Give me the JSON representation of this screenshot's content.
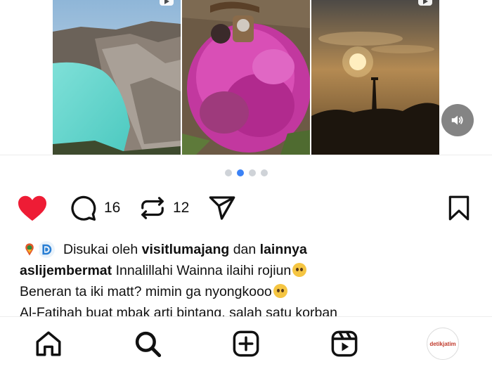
{
  "media": {
    "tiles": [
      {
        "name": "crater-lake-photo",
        "badge": "reel-icon"
      },
      {
        "name": "flower-grave-photo",
        "badge": "none"
      },
      {
        "name": "sunset-tower-photo",
        "badge": "reel-icon"
      }
    ],
    "volume_icon": "speaker-icon"
  },
  "carousel": {
    "total": 4,
    "active_index": 1
  },
  "actions": {
    "liked": true,
    "like_color": "#ee1c35",
    "comments_count": "16",
    "reposts_count": "12"
  },
  "caption": {
    "likes_prefix": "Disukai oleh",
    "liked_by_user": "visitlumajang",
    "likes_join": "dan",
    "likes_others": "lainnya",
    "author": "aslijembermat",
    "line1_text": "Innalillahi Wainna ilaihi rojiun",
    "line2_text": "Beneran ta iki matt? mimin ga nyongkooo",
    "line3_text": "Al-Fatihah buat mbak arti bintang, salah satu korban"
  },
  "bottom_nav": {
    "items": [
      "home-icon",
      "search-icon",
      "create-icon",
      "reels-icon",
      "profile-avatar"
    ],
    "profile_label": "detikjatim"
  },
  "colors": {
    "accent_blue": "#3b82f6",
    "heart_red": "#ee1c35"
  }
}
